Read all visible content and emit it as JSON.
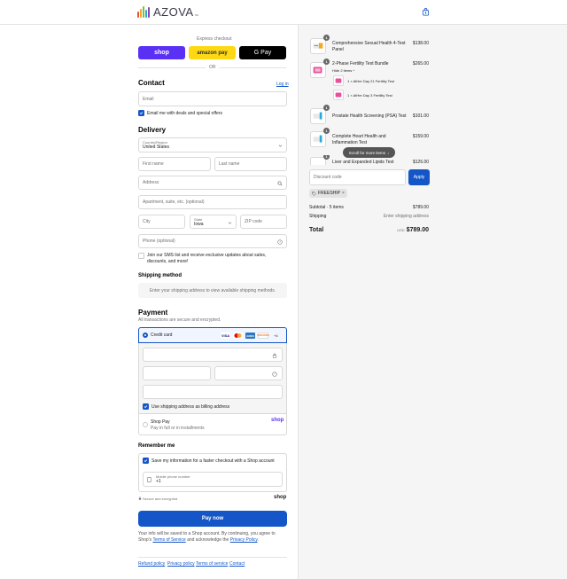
{
  "brand": {
    "name": "AZOVA",
    "tm": "™"
  },
  "express": {
    "label": "Express checkout",
    "shop": "shop",
    "amazon": "amazon pay",
    "gpay": "G Pay",
    "or": "OR"
  },
  "contact": {
    "title": "Contact",
    "login": "Log in",
    "email_placeholder": "Email",
    "news_label": "Email me with deals and special offers"
  },
  "delivery": {
    "title": "Delivery",
    "country_label": "Country/Region",
    "country_value": "United States",
    "first_name": "First name",
    "last_name": "Last name",
    "address": "Address",
    "apartment": "Apartment, suite, etc. (optional)",
    "city": "City",
    "state_label": "State",
    "state_value": "Iowa",
    "zip": "ZIP code",
    "phone": "Phone (optional)",
    "sms_label": "Join our SMS list and receive exclusive updates about sales, discounts, and more!"
  },
  "shipping_method": {
    "title": "Shipping method",
    "message": "Enter your shipping address to view available shipping methods."
  },
  "payment": {
    "title": "Payment",
    "subtitle": "All transactions are secure and encrypted.",
    "credit_card": "Credit card",
    "cards": [
      "VISA",
      "MC",
      "AMEX",
      "DISCOVER"
    ],
    "more": "+4",
    "billing_label": "Use shipping address as billing address",
    "shop_pay": "Shop Pay",
    "shop_pay_sub": "Pay in full or in installments",
    "shop_pay_logo": "shop"
  },
  "remember": {
    "title": "Remember me",
    "save_label": "Save my information for a faster checkout with a Shop account",
    "phone_label": "Mobile phone number",
    "phone_value": "+1",
    "secure": "Secure and encrypted",
    "shop_logo": "shop"
  },
  "pay_button": "Pay now",
  "legal": {
    "line1": "Your info will be saved to a Shop account. By continuing, you agree to Shop's",
    "terms": "Terms of Service",
    "and": "and acknowledge the",
    "privacy": "Privacy Policy",
    "period": "."
  },
  "footer": [
    "Refund policy",
    "Privacy policy",
    "Terms of service",
    "Contact"
  ],
  "cart": {
    "items": [
      {
        "qty": "1",
        "name": "Comprehensive Sexual Health 4-Test Panel",
        "price": "$138.00"
      },
      {
        "qty": "1",
        "name": "2-Phase Fertility Test Bundle",
        "price": "$265.00",
        "hide": "Hide 2 items",
        "sub": [
          "1 × AtHer Day 21 Fertility Test",
          "1 × AtHer Day 3 Fertility Test"
        ]
      },
      {
        "qty": "1",
        "name": "Prostate Health Screening (PSA) Test",
        "price": "$101.00"
      },
      {
        "qty": "1",
        "name": "Complete Heart Health and Inflammation Test",
        "price": "$159.00"
      },
      {
        "qty": "1",
        "name": "Liver and Expanded Lipids Test",
        "price": "$126.00"
      }
    ],
    "scroll_hint": "Scroll for more items",
    "discount_placeholder": "Discount code",
    "apply": "Apply",
    "tag": "FREESHIP",
    "subtotal_label": "Subtotal · 5 items",
    "subtotal_value": "$789.00",
    "shipping_label": "Shipping",
    "shipping_value": "Enter shipping address",
    "total_label": "Total",
    "currency": "USD",
    "total_value": "$789.00"
  }
}
